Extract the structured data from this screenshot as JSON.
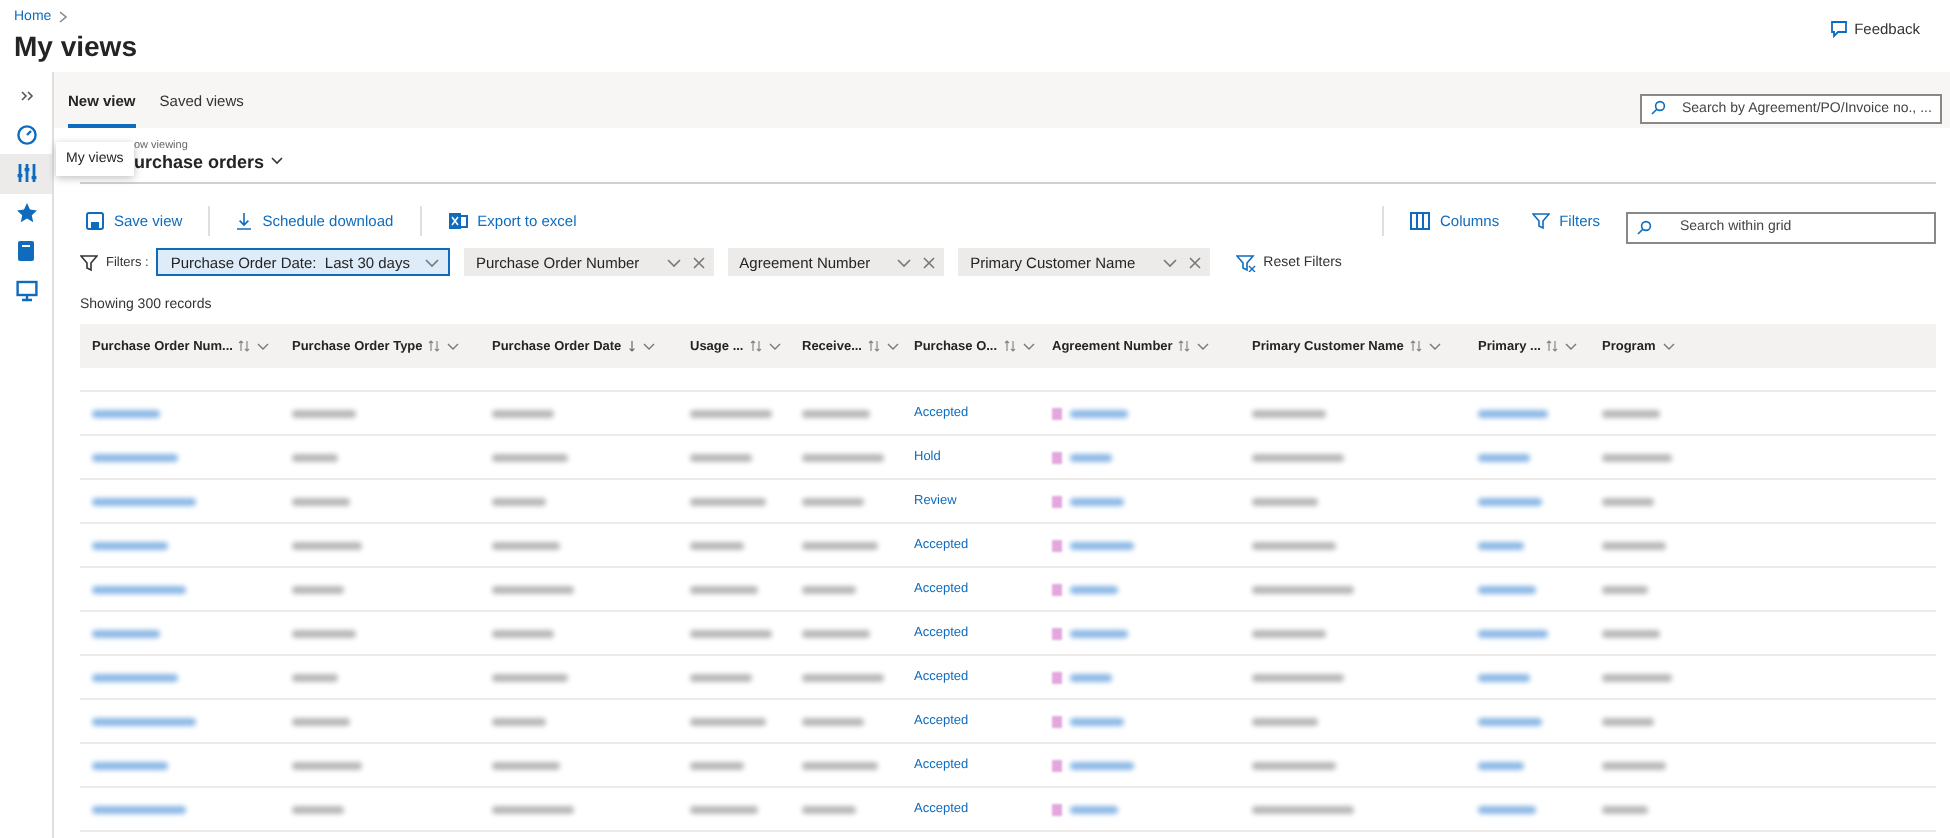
{
  "breadcrumb": [
    "Home"
  ],
  "page_title": "My views",
  "feedback": "Feedback",
  "sidebar": {
    "items": [
      {
        "kind": "expand",
        "selected": false
      },
      {
        "kind": "gauge",
        "selected": false
      },
      {
        "kind": "sliders",
        "selected": true
      },
      {
        "kind": "star",
        "selected": false
      },
      {
        "kind": "book",
        "selected": false
      },
      {
        "kind": "monitor",
        "selected": false
      }
    ]
  },
  "tooltip": "My views",
  "tabs": [
    {
      "label": "New view",
      "selected": true
    },
    {
      "label": "Saved views",
      "selected": false
    }
  ],
  "global_search": {
    "placeholder": "Search by Agreement/PO/Invoice no., ..."
  },
  "view": {
    "caption": "ow viewing",
    "title": "urchase orders"
  },
  "toolbar": {
    "left": [
      {
        "label": "Save view",
        "kind": "save"
      },
      {
        "label": "Schedule download",
        "kind": "download"
      },
      {
        "label": "Export to excel",
        "kind": "excel"
      }
    ],
    "right": [
      {
        "label": "Columns",
        "kind": "columns"
      },
      {
        "label": "Filters",
        "kind": "filter"
      }
    ],
    "search": {
      "placeholder": "Search within grid"
    }
  },
  "filters": {
    "label": "Filters :",
    "chips": [
      {
        "label": "Purchase Order Date:  Last 30 days",
        "selected": true
      },
      {
        "label": "Purchase Order Number",
        "selected": false
      },
      {
        "label": "Agreement Number",
        "selected": false
      },
      {
        "label": "Primary Customer Name",
        "selected": false
      }
    ],
    "reset": "Reset Filters"
  },
  "records": "Showing 300 records",
  "table": {
    "columns": [
      {
        "label": "Purchase Order Num...",
        "sortable": true,
        "sorted": false,
        "kind": "link"
      },
      {
        "label": "Purchase Order Type",
        "sortable": true,
        "sorted": false,
        "kind": "text"
      },
      {
        "label": "Purchase Order Date",
        "sortable": true,
        "sorted": true,
        "kind": "text"
      },
      {
        "label": "Usage ...",
        "sortable": true,
        "sorted": false,
        "kind": "text"
      },
      {
        "label": "Receive...",
        "sortable": true,
        "sorted": false,
        "kind": "text"
      },
      {
        "label": "Purchase O...",
        "sortable": true,
        "sorted": false,
        "kind": "status"
      },
      {
        "label": "Agreement Number",
        "sortable": true,
        "sorted": false,
        "kind": "agreement"
      },
      {
        "label": "Primary Customer Name",
        "sortable": true,
        "sorted": false,
        "kind": "text"
      },
      {
        "label": "Primary ...",
        "sortable": true,
        "sorted": false,
        "kind": "link"
      },
      {
        "label": "Program",
        "sortable": false,
        "sorted": false,
        "kind": "text"
      }
    ],
    "rows": [
      {
        "status": "Accepted"
      },
      {
        "status": "Hold"
      },
      {
        "status": "Review"
      },
      {
        "status": "Accepted"
      },
      {
        "status": "Accepted"
      },
      {
        "status": "Accepted"
      },
      {
        "status": "Accepted"
      },
      {
        "status": "Accepted"
      },
      {
        "status": "Accepted"
      },
      {
        "status": "Accepted"
      }
    ]
  }
}
